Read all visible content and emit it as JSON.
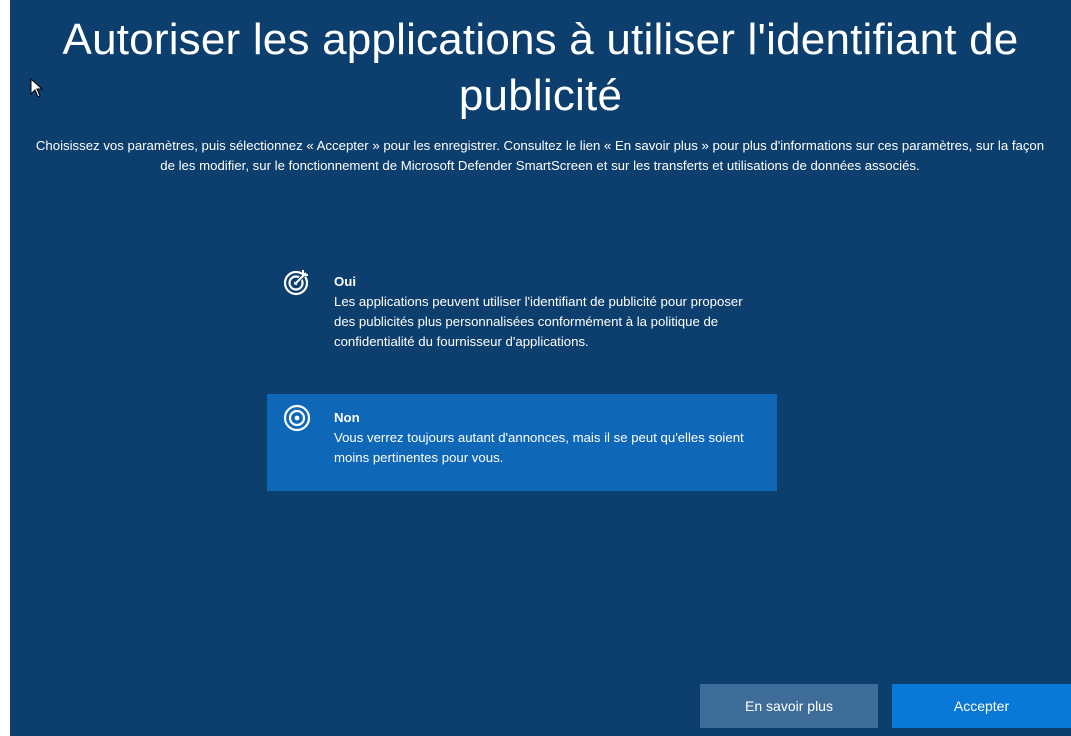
{
  "page": {
    "title": "Autoriser les applications à utiliser l'identifiant de publicité",
    "description": "Choisissez vos paramètres, puis sélectionnez « Accepter » pour les enregistrer. Consultez le lien « En savoir plus » pour plus d'informations sur ces paramètres, sur la façon de les modifier, sur le fonctionnement de Microsoft Defender SmartScreen et sur les transferts et utilisations de données associés."
  },
  "options": [
    {
      "title": "Oui",
      "description": "Les applications peuvent utiliser l'identifiant de publicité pour proposer des publicités plus personnalisées conformément à la politique de confidentialité du fournisseur d'applications.",
      "icon": "target-arrow-icon",
      "selected": false
    },
    {
      "title": "Non",
      "description": "Vous verrez toujours autant d'annonces, mais il se peut qu'elles soient moins pertinentes pour vous.",
      "icon": "target-icon",
      "selected": true
    }
  ],
  "buttons": {
    "learn_more": "En savoir plus",
    "accept": "Accepter"
  },
  "colors": {
    "background": "#0c3f6e",
    "selected_option": "#0f67b8",
    "secondary_button": "#3d6d98",
    "primary_button": "#0a78d7"
  }
}
